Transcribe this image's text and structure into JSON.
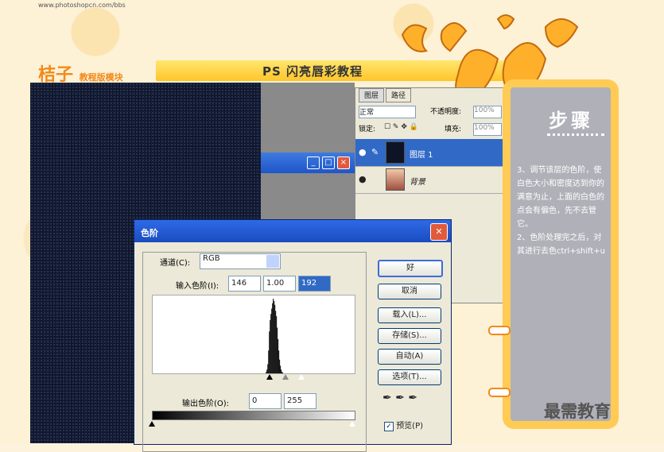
{
  "site": {
    "url": "www.photoshopcn.com/bbs"
  },
  "logo": {
    "main": "桔子",
    "sub": "教程版模块"
  },
  "banner": {
    "title": "PS 闪亮唇彩教程"
  },
  "ps_window": {
    "minimize": "_",
    "maximize": "□",
    "close": "×"
  },
  "layers_panel": {
    "tabs": [
      "图层",
      "路径"
    ],
    "blend_mode": "正常",
    "opacity_label": "不透明度:",
    "opacity_value": "100%",
    "lock_label": "锁定:",
    "fill_label": "填充:",
    "fill_value": "100%",
    "layers": [
      {
        "name": "图层 1"
      },
      {
        "name": "背景"
      }
    ]
  },
  "sidebar": {
    "title": "步骤",
    "steps": "3、调节该层的色阶，使白色大小和密度达到你的满意为止，上面的白色的点会有偏色，先不去管它。\n2、色阶处理完之后，对其进行去色ctrl+shift+u"
  },
  "levels_dialog": {
    "title": "色阶",
    "channel_label": "通道(C):",
    "channel_value": "RGB",
    "input_label": "输入色阶(I):",
    "input_black": "146",
    "input_gamma": "1.00",
    "input_white": "192",
    "output_label": "输出色阶(O):",
    "output_black": "0",
    "output_white": "255",
    "buttons": {
      "ok": "好",
      "cancel": "取消",
      "load": "载入(L)...",
      "save": "存储(S)...",
      "auto": "自动(A)",
      "options": "选项(T)..."
    },
    "preview_label": "预览(P)",
    "preview_checked": true
  },
  "histogram": [
    0,
    0,
    0,
    0,
    0,
    0,
    0,
    0,
    0,
    0,
    0,
    0,
    0,
    0,
    0,
    0,
    0,
    0,
    0,
    0,
    0,
    0,
    0,
    0,
    0,
    0,
    0,
    0,
    0,
    0,
    0,
    0,
    0,
    0,
    0,
    0,
    0,
    0,
    0,
    0,
    0,
    0,
    0,
    0,
    0,
    0,
    0,
    0,
    0,
    0,
    0,
    0,
    0,
    0,
    0,
    0,
    0,
    0,
    0,
    0,
    0,
    0,
    0,
    0,
    0,
    0,
    0,
    0,
    0,
    0,
    0,
    0,
    0,
    0,
    0,
    0,
    0,
    0,
    0,
    0,
    0,
    0,
    0,
    0,
    0,
    0,
    0,
    0,
    0,
    0,
    0,
    0,
    0,
    0,
    0,
    0,
    0,
    0,
    0,
    0,
    0,
    0,
    0,
    0,
    0,
    0,
    0,
    0,
    0,
    0,
    0,
    0,
    0,
    0,
    0,
    0,
    0,
    0,
    0,
    0,
    0,
    0,
    0,
    0,
    0,
    0,
    0,
    0,
    0,
    0,
    0,
    0,
    0,
    0,
    0,
    0,
    0,
    0,
    0,
    0,
    0,
    0,
    0,
    0,
    2,
    5,
    12,
    30,
    55,
    70,
    78,
    85,
    92,
    98,
    95,
    90,
    82,
    75,
    60,
    45,
    30,
    18,
    10,
    5,
    2,
    1,
    0,
    0,
    0,
    0,
    0,
    0,
    0,
    0,
    0,
    0,
    0,
    0,
    0,
    0,
    0,
    0,
    0,
    0,
    0,
    0,
    0,
    0,
    0,
    0,
    0,
    0,
    0,
    0,
    0,
    0,
    0,
    0,
    0,
    0,
    0,
    0,
    0,
    0,
    0,
    0,
    0,
    0,
    0,
    0,
    0,
    0,
    0,
    0,
    0,
    0,
    0,
    0,
    0,
    0,
    0,
    0,
    0,
    0,
    0,
    0,
    0,
    0,
    0,
    0,
    0,
    0,
    0,
    0,
    0,
    0,
    0,
    0,
    0,
    0,
    0,
    0,
    0,
    0,
    0,
    0,
    0,
    0,
    0,
    0,
    0,
    0,
    0,
    0,
    0,
    0,
    0
  ],
  "watermark": "最需教育",
  "colors": {
    "orange": "#f08a1a",
    "sidebar": "#ffcb54",
    "titlebar_blue": "#2e6ae6"
  }
}
